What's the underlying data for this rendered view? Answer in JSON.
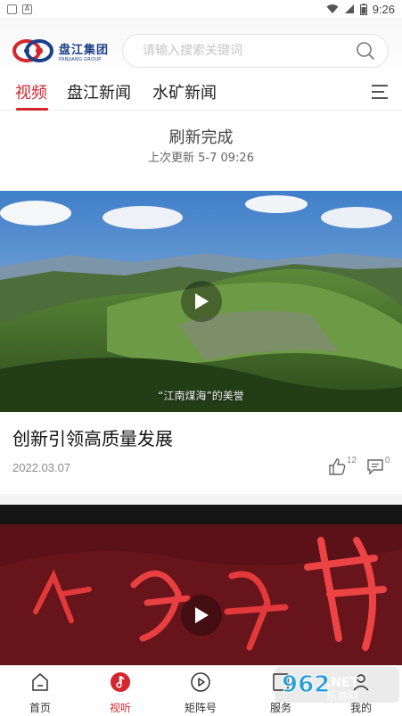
{
  "statusbar": {
    "time": "9:26"
  },
  "header": {
    "logo_text": "盘江集团",
    "logo_sub": "PANJIANG GROUP",
    "search_placeholder": "请输入搜索关键词"
  },
  "tabs": [
    {
      "label": "视频",
      "active": true
    },
    {
      "label": "盘江新闻",
      "active": false
    },
    {
      "label": "水矿新闻",
      "active": false
    }
  ],
  "refresh": {
    "title": "刷新完成",
    "time": "上次更新 5-7 09:26"
  },
  "videos": [
    {
      "caption": "“江南煤海”的美誉",
      "title": "创新引领高质量发展",
      "date": "2022.03.07",
      "likes": "12",
      "comments": "0"
    },
    {
      "title": "",
      "date": ""
    }
  ],
  "bottom_nav": [
    {
      "label": "首页",
      "icon": "home-icon",
      "active": false
    },
    {
      "label": "视听",
      "icon": "music-note-icon",
      "active": true
    },
    {
      "label": "矩阵号",
      "icon": "play-icon",
      "active": false
    },
    {
      "label": "服务",
      "icon": "service-icon",
      "active": false
    },
    {
      "label": "我的",
      "icon": "user-icon",
      "active": false
    }
  ],
  "watermark": {
    "text": "962",
    "suffix": ".NET",
    "sub": "乐游网"
  },
  "colors": {
    "accent": "#d3262e",
    "brand_blue": "#1c3f8a"
  }
}
